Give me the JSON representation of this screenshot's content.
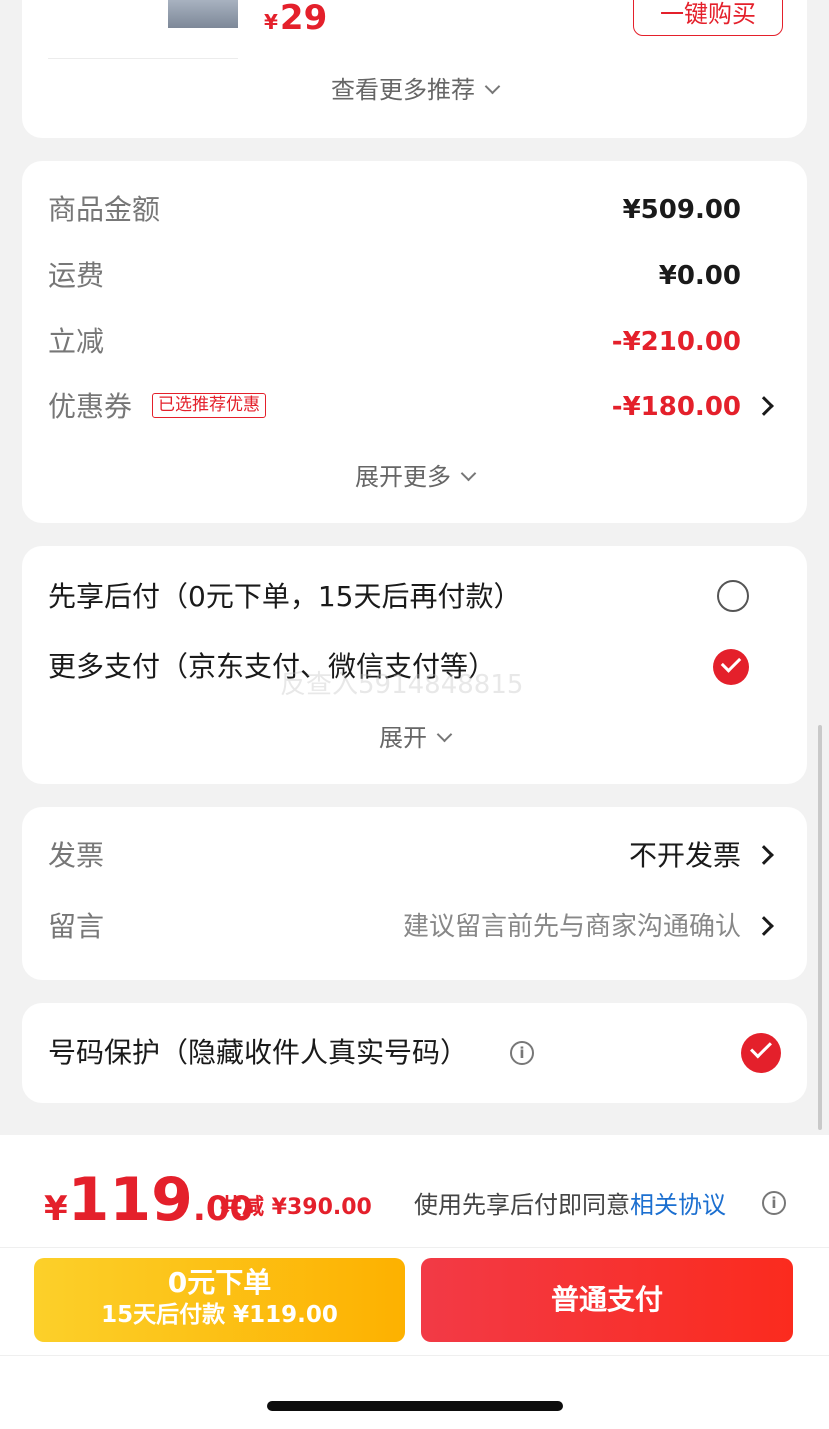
{
  "recommend": {
    "price_symbol": "¥",
    "price": "29",
    "buy_button": "一键购买",
    "see_more": "查看更多推荐"
  },
  "summary": {
    "rows": [
      {
        "label": "商品金额",
        "value": "¥509.00"
      },
      {
        "label": "运费",
        "value": "¥0.00"
      },
      {
        "label": "立减",
        "value": "-¥210.00"
      },
      {
        "label": "优惠券",
        "tag": "已选推荐优惠",
        "value": "-¥180.00"
      }
    ],
    "expand_more": "展开更多"
  },
  "payment": {
    "options": [
      {
        "label": "先享后付（0元下单，15天后再付款）",
        "selected": false
      },
      {
        "label": "更多支付（京东支付、微信支付等）",
        "selected": true
      }
    ],
    "watermark": "反查入5914848815",
    "expand": "展开"
  },
  "extras": {
    "invoice_label": "发票",
    "invoice_value": "不开发票",
    "message_label": "留言",
    "message_placeholder": "建议留言前先与商家沟通确认"
  },
  "privacy": {
    "label": "号码保护（隐藏收件人真实号码）",
    "info_icon": "i",
    "checked": true
  },
  "bottom": {
    "currency": "¥",
    "total_int": "119",
    "total_dec": ".00",
    "discount": "共减 ¥390.00",
    "agreement_prefix": "使用先享后付即同意",
    "agreement_link": "相关协议",
    "info_icon": "i",
    "bnpl_line1": "0元下单",
    "bnpl_line2": "15天后付款 ¥119.00",
    "pay_button": "普通支付"
  },
  "colors": {
    "accent_red": "#e4202b",
    "link_blue": "#1b6fd0",
    "bnpl_yellow": "#fdb100"
  }
}
